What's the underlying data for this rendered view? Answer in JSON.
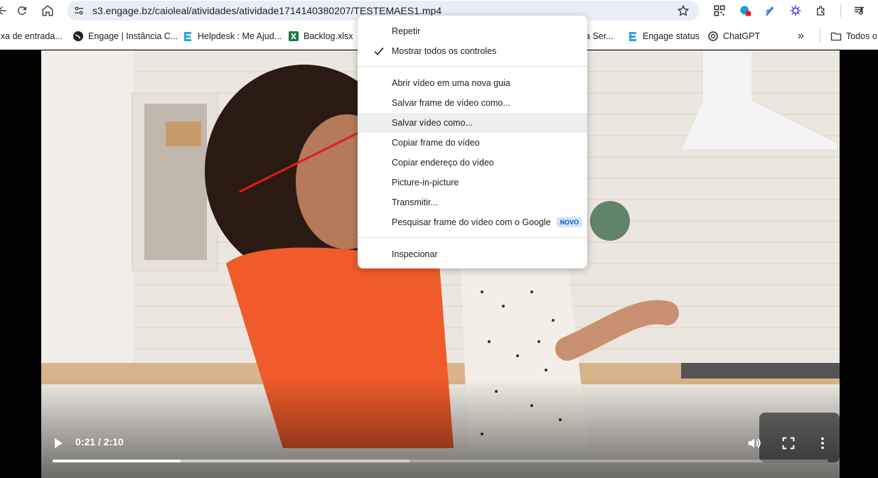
{
  "browser": {
    "url": "s3.engage.bz/caioleal/atividades/atividade1714140380207/TESTEMAES1.mp4"
  },
  "bookmarks": [
    {
      "label": "ixa de entrada..."
    },
    {
      "label": "Engage | Instância C..."
    },
    {
      "label": "Helpdesk : Me Ajud..."
    },
    {
      "label": "Backlog.xlsx"
    },
    {
      "label": "ra Ser..."
    },
    {
      "label": "Engage status"
    },
    {
      "label": "ChatGPT"
    }
  ],
  "bookmarks_folder": "Todos o",
  "video": {
    "current_time": "0:21",
    "separator": "/",
    "duration": "2:10",
    "played_fraction": 0.165,
    "buffered_fraction": 0.46
  },
  "context_menu": {
    "items": [
      {
        "label": "Repetir",
        "checked": false
      },
      {
        "label": "Mostrar todos os controles",
        "checked": true
      },
      {
        "label": "Abrir vídeo em uma nova guia"
      },
      {
        "label": "Salvar frame de vídeo como..."
      },
      {
        "label": "Salvar vídeo como...",
        "highlighted": true
      },
      {
        "label": "Copiar frame do vídeo"
      },
      {
        "label": "Copiar endereço do vídeo"
      },
      {
        "label": "Picture-in-picture"
      },
      {
        "label": "Transmitir..."
      },
      {
        "label": "Pesquisar frame do vídeo com o Google",
        "badge": "NOVO"
      },
      {
        "label": "Inspecionar"
      }
    ]
  },
  "colors": {
    "annotation_arrow": "#e21b1b",
    "omnibox_bg": "#e9eef6",
    "badge_bg": "#d3e3fd",
    "badge_text": "#0b57d0"
  }
}
